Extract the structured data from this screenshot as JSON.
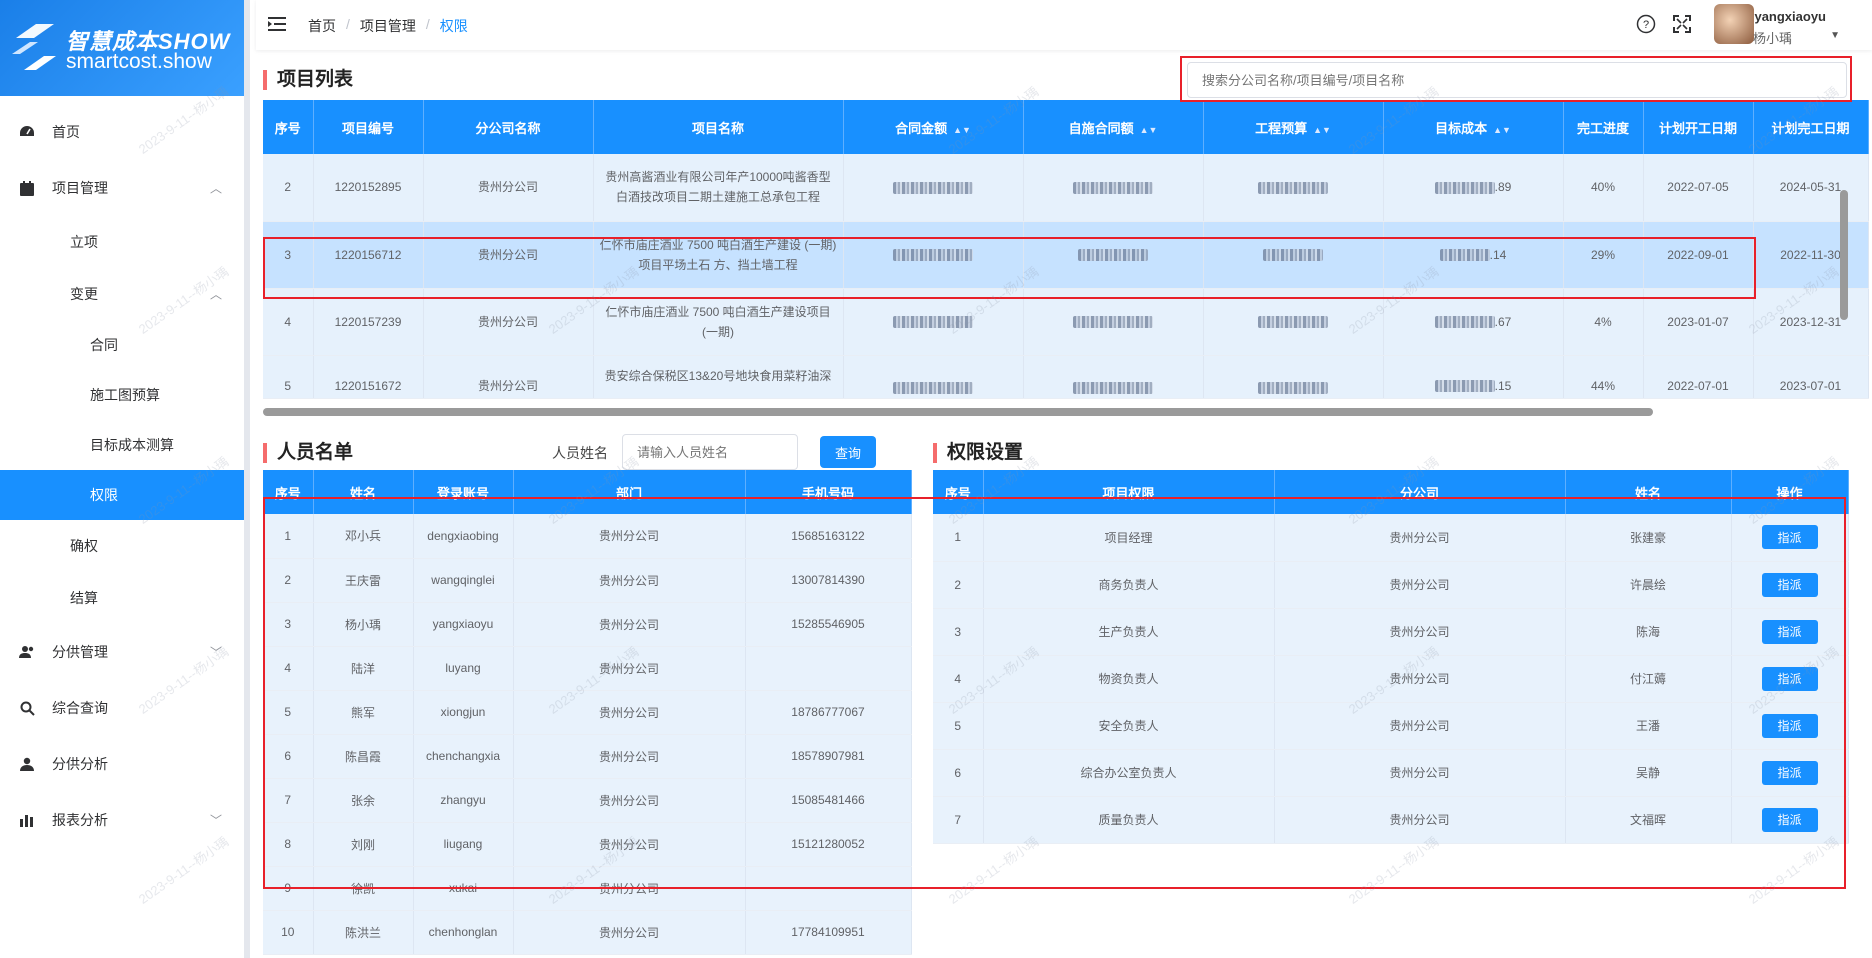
{
  "logo": {
    "cn": "智慧成本SHOW",
    "en": "smartcost.show"
  },
  "sidebar": {
    "items": [
      {
        "label": "首页",
        "icon": "dashboard-icon"
      },
      {
        "label": "项目管理",
        "icon": "calendar-icon",
        "expanded": true
      },
      {
        "label": "立项"
      },
      {
        "label": "变更",
        "expanded": true
      },
      {
        "label": "合同"
      },
      {
        "label": "施工图预算"
      },
      {
        "label": "目标成本测算"
      },
      {
        "label": "权限",
        "active": true
      },
      {
        "label": "确权"
      },
      {
        "label": "结算"
      },
      {
        "label": "分供管理",
        "icon": "users-icon"
      },
      {
        "label": "综合查询",
        "icon": "search-icon"
      },
      {
        "label": "分供分析",
        "icon": "user-icon"
      },
      {
        "label": "报表分析",
        "icon": "bar-chart-icon"
      }
    ]
  },
  "breadcrumb": {
    "home": "首页",
    "module": "项目管理",
    "current": "权限"
  },
  "user": {
    "account": "yangxiaoyu",
    "name": "杨小瑀"
  },
  "project": {
    "title": "项目列表",
    "search_placeholder": "搜索分公司名称/项目编号/项目名称",
    "headers": [
      "序号",
      "项目编号",
      "分公司名称",
      "项目名称",
      "合同金额",
      "自施合同额",
      "工程预算",
      "目标成本",
      "完工进度",
      "计划开工日期",
      "计划完工日期"
    ],
    "rows": [
      {
        "no": "2",
        "code": "1220152895",
        "branch": "贵州分公司",
        "name": "贵州高酱酒业有限公司年产10000吨酱香型白酒技改项目二期土建施工总承包工程",
        "cost_tail": ".89",
        "progress": "40%",
        "start": "2022-07-05",
        "end": "2024-05-31"
      },
      {
        "no": "3",
        "code": "1220156712",
        "branch": "贵州分公司",
        "name": "仁怀市庙庄酒业 7500 吨白酒生产建设 (一期) 项目平场土石 方、挡土墙工程",
        "cost_tail": ".14",
        "progress": "29%",
        "start": "2022-09-01",
        "end": "2022-11-30"
      },
      {
        "no": "4",
        "code": "1220157239",
        "branch": "贵州分公司",
        "name": "仁怀市庙庄酒业 7500 吨白酒生产建设项目 (一期)",
        "cost_tail": ".67",
        "progress": "4%",
        "start": "2023-01-07",
        "end": "2023-12-31"
      },
      {
        "no": "5",
        "code": "1220151672",
        "branch": "贵州分公司",
        "name": "贵安综合保税区13&20号地块食用菜籽油深",
        "cost_tail": ".15",
        "progress": "44%",
        "start": "2022-07-01",
        "end": "2023-07-01"
      }
    ]
  },
  "personnel": {
    "title": "人员名单",
    "name_label": "人员姓名",
    "name_placeholder": "请输入人员姓名",
    "query_button": "查询",
    "headers": [
      "序号",
      "姓名",
      "登录账号",
      "部门",
      "手机号码"
    ],
    "rows": [
      [
        "1",
        "邓小兵",
        "dengxiaobing",
        "贵州分公司",
        "15685163122"
      ],
      [
        "2",
        "王庆雷",
        "wangqinglei",
        "贵州分公司",
        "13007814390"
      ],
      [
        "3",
        "杨小瑀",
        "yangxiaoyu",
        "贵州分公司",
        "15285546905"
      ],
      [
        "4",
        "陆洋",
        "luyang",
        "贵州分公司",
        ""
      ],
      [
        "5",
        "熊军",
        "xiongjun",
        "贵州分公司",
        "18786777067"
      ],
      [
        "6",
        "陈昌霞",
        "chenchangxia",
        "贵州分公司",
        "18578907981"
      ],
      [
        "7",
        "张余",
        "zhangyu",
        "贵州分公司",
        "15085481466"
      ],
      [
        "8",
        "刘刚",
        "liugang",
        "贵州分公司",
        "15121280052"
      ],
      [
        "9",
        "徐凯",
        "xukai",
        "贵州分公司",
        ""
      ],
      [
        "10",
        "陈洪兰",
        "chenhonglan",
        "贵州分公司",
        "17784109951"
      ]
    ]
  },
  "permissions": {
    "title": "权限设置",
    "headers": [
      "序号",
      "项目权限",
      "分公司",
      "姓名",
      "操作"
    ],
    "action_label": "指派",
    "rows": [
      [
        "1",
        "项目经理",
        "贵州分公司",
        "张建豪"
      ],
      [
        "2",
        "商务负责人",
        "贵州分公司",
        "许晨绘"
      ],
      [
        "3",
        "生产负责人",
        "贵州分公司",
        "陈海"
      ],
      [
        "4",
        "物资负责人",
        "贵州分公司",
        "付江薅"
      ],
      [
        "5",
        "安全负责人",
        "贵州分公司",
        "王潘"
      ],
      [
        "6",
        "综合办公室负责人",
        "贵州分公司",
        "吴静"
      ],
      [
        "7",
        "质量负责人",
        "贵州分公司",
        "文福晖"
      ]
    ]
  },
  "watermark": "2023-9-11--杨小瑀",
  "colors": {
    "primary": "#1890ff",
    "highlight": "#e8202a",
    "accent_bar": "#f56c6c"
  }
}
